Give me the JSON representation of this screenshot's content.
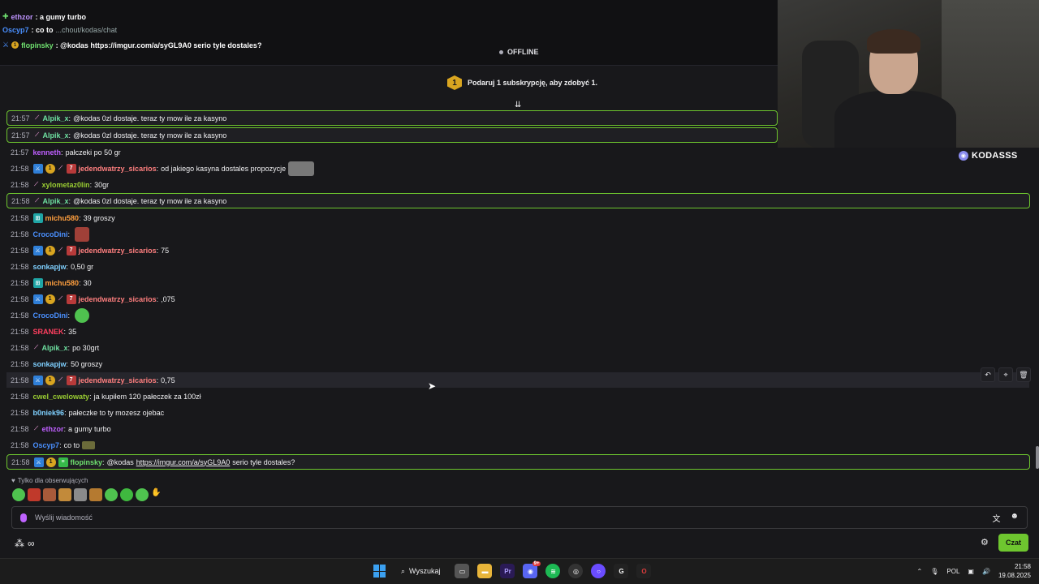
{
  "overlay": {
    "lines": [
      {
        "user": "ethzor",
        "text": ": a gumy turbo",
        "color": "purple"
      },
      {
        "user": "Oscyp7",
        "text": ": co to",
        "ghost": "...chout/kodas/chat",
        "color": "blue"
      },
      {
        "user": "flopinsky",
        "text": ": @kodas https://imgur.com/a/syGL9A0 serio tyle dostales?",
        "color": "green"
      }
    ],
    "status": "OFFLINE"
  },
  "sub_promo": {
    "badge": "1",
    "text": "Podaruj 1 subskrypcję, aby zdobyć 1."
  },
  "webcam": {
    "channel": "KODASSS"
  },
  "chat": {
    "messages": [
      {
        "time": "21:57",
        "user": "Alpik_x",
        "sep": ":",
        "text": "@kodas 0zl dostaje. teraz ty mow ile za kasyno",
        "color": "#6ee0a0"
      },
      {
        "time": "21:57",
        "user": "Alpik_x",
        "sep": ":",
        "text": "@kodas 0zl dostaje. teraz ty mow ile za kasyno",
        "color": "#6ee0a0"
      },
      {
        "time": "21:57",
        "user": "kenneth",
        "sep": ":",
        "text": "pałczeki po 50 gr",
        "color": "#bf5fff"
      },
      {
        "time": "21:58",
        "user": "jedendwatrzy_sicarios",
        "sep": ":",
        "text": "od jakiego kasyna dostales propozycje",
        "color": "#ff7f7f"
      },
      {
        "time": "21:58",
        "user": "xylometaz0lin",
        "sep": ":",
        "text": "30gr",
        "color": "#9acd32"
      },
      {
        "time": "21:58",
        "user": "Alpik_x",
        "sep": ":",
        "text": "@kodas 0zl dostaje. teraz ty mow ile za kasyno",
        "color": "#6ee0a0"
      },
      {
        "time": "21:58",
        "user": "michu580",
        "sep": ":",
        "text": "39 groszy",
        "color": "#ff9f3f"
      },
      {
        "time": "21:58",
        "user": "CrocoDini",
        "sep": ":",
        "text": "",
        "color": "#4a90ff"
      },
      {
        "time": "21:58",
        "user": "jedendwatrzy_sicarios",
        "sep": ":",
        "text": "75",
        "color": "#ff7f7f"
      },
      {
        "time": "21:58",
        "user": "sonkapjw",
        "sep": ":",
        "text": "0,50 gr",
        "color": "#7fd0ff"
      },
      {
        "time": "21:58",
        "user": "michu580",
        "sep": ":",
        "text": "30",
        "color": "#ff9f3f"
      },
      {
        "time": "21:58",
        "user": "jedendwatrzy_sicarios",
        "sep": ":",
        "text": ",075",
        "color": "#ff7f7f"
      },
      {
        "time": "21:58",
        "user": "CrocoDini",
        "sep": ":",
        "text": "",
        "color": "#4a90ff"
      },
      {
        "time": "21:58",
        "user": "SRANEK",
        "sep": ":",
        "text": "35",
        "color": "#ff3f5f"
      },
      {
        "time": "21:58",
        "user": "Alpik_x",
        "sep": ":",
        "text": "po 30grt",
        "color": "#6ee0a0"
      },
      {
        "time": "21:58",
        "user": "sonkapjw",
        "sep": ":",
        "text": "50 groszy",
        "color": "#7fd0ff"
      },
      {
        "time": "21:58",
        "user": "jedendwatrzy_sicarios",
        "sep": ":",
        "text": "0,75",
        "color": "#ff7f7f"
      },
      {
        "time": "21:58",
        "user": "cwel_cwelowaty",
        "sep": ":",
        "text": "ja kupiłem 120 pałeczek za 100zł",
        "color": "#9acd32"
      },
      {
        "time": "21:58",
        "user": "b0niek96",
        "sep": ":",
        "text": "pałeczke to ty mozesz ojebac",
        "color": "#7fd0ff"
      },
      {
        "time": "21:58",
        "user": "ethzor",
        "sep": ":",
        "text": "a gumy turbo",
        "color": "#bf5fff"
      },
      {
        "time": "21:58",
        "user": "Oscyp7",
        "sep": ":",
        "text": "co to",
        "color": "#4a90ff"
      },
      {
        "time": "21:58",
        "user": "flopinsky",
        "sep": ":",
        "text": "@kodas",
        "link": "https://imgur.com/a/syGL9A0",
        "after": "serio tyle dostales?",
        "color": "#6fe06f"
      }
    ]
  },
  "composer": {
    "followers_only": "Tylko dla obserwujących",
    "placeholder": "Wyślij wiadomość",
    "chat_button": "Czat"
  },
  "taskbar": {
    "search": "Wyszukaj",
    "lang": "POL",
    "time": "21:58",
    "date": "19.08.2025",
    "discord_badge": "9+"
  }
}
